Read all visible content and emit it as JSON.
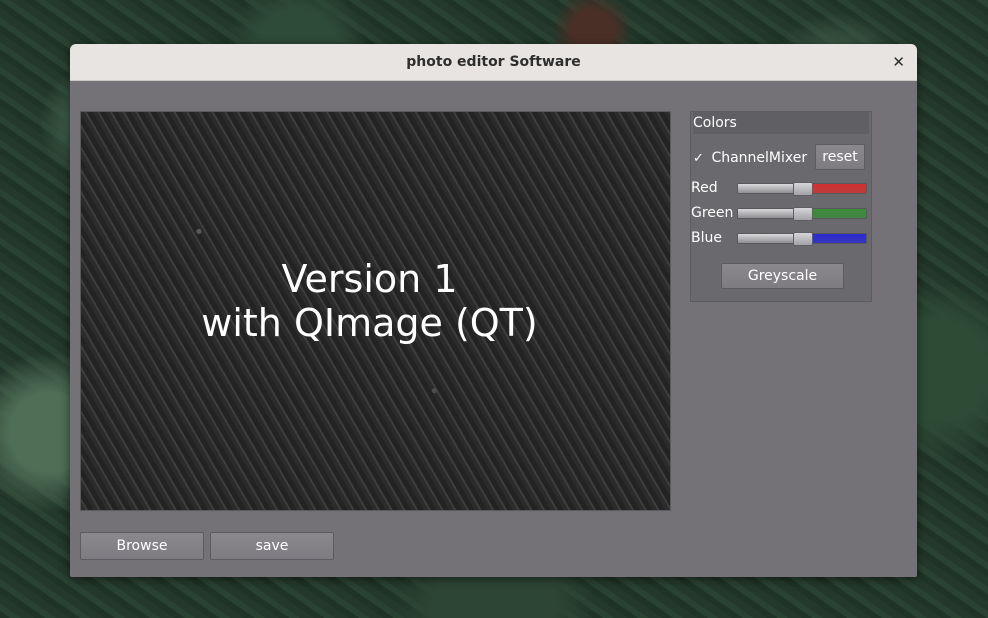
{
  "window": {
    "title": "photo editor Software",
    "close_glyph": "✕"
  },
  "image": {
    "line1": "Version 1",
    "line2": "with QImage (QT)"
  },
  "buttons": {
    "browse": "Browse",
    "save": "save"
  },
  "colors_panel": {
    "title": "Colors",
    "channelmixer_label": "ChannelMixer",
    "channelmixer_checked": true,
    "check_glyph": "✓",
    "reset_label": "reset",
    "greyscale_label": "Greyscale",
    "sliders": [
      {
        "label": "Red",
        "value": 0.5,
        "color": "#d23030"
      },
      {
        "label": "Green",
        "value": 0.5,
        "color": "#3a8c3a"
      },
      {
        "label": "Blue",
        "value": 0.5,
        "color": "#2a2ad0"
      }
    ]
  }
}
